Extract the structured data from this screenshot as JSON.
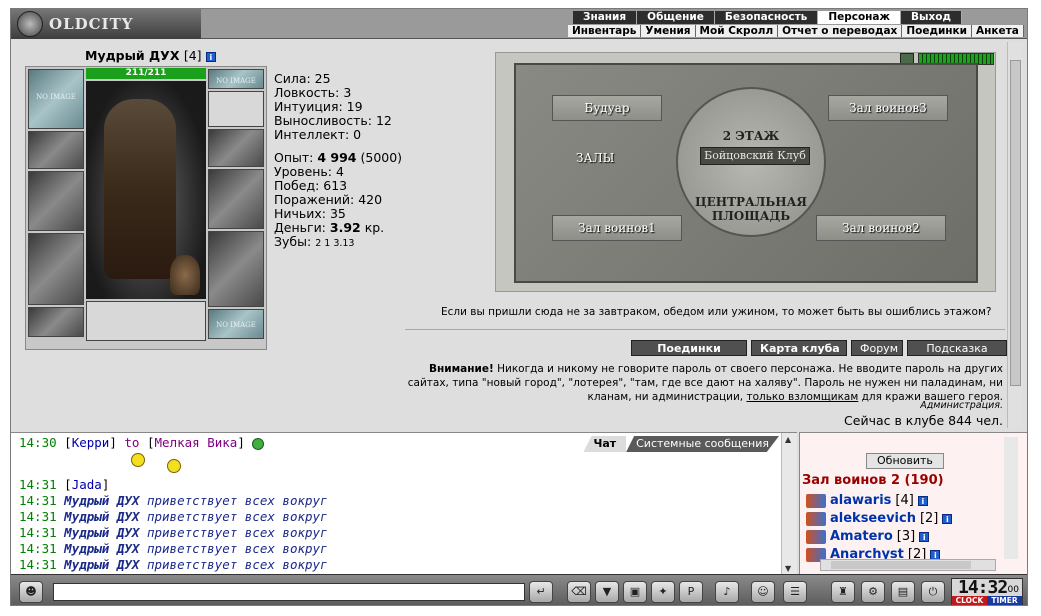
{
  "logo": {
    "text": "OLDCITY"
  },
  "nav_primary": [
    {
      "label": "Знания",
      "active": false
    },
    {
      "label": "Общение",
      "active": false
    },
    {
      "label": "Безопасность",
      "active": false
    },
    {
      "label": "Персонаж",
      "active": true
    },
    {
      "label": "Выход",
      "active": false
    }
  ],
  "nav_secondary": [
    "Инвентарь",
    "Умения",
    "Мой Скролл",
    "Отчет о переводах",
    "Поединки",
    "Анкета"
  ],
  "character": {
    "name": "Мудрый ДУХ",
    "level": "[4]",
    "info_icon": "i",
    "hp": "211/211",
    "hp_fraction": 1.0,
    "slot_noimage_label": "NO IMAGE"
  },
  "stats": {
    "strength": "Сила: 25",
    "agility": "Ловкость: 3",
    "intuition": "Интуиция: 19",
    "endurance": "Выносливость: 12",
    "intellect": "Интеллект: 0",
    "exp_label": "Опыт: ",
    "exp_value": "4 994",
    "exp_next": " (5000)",
    "level": "Уровень: 4",
    "wins": "Побед: 613",
    "losses": "Поражений: 420",
    "draws": "Ничьих: 35",
    "money_label": "Деньги: ",
    "money_value": "3.92",
    "money_unit": " кр.",
    "teeth_label": "Зубы: ",
    "teeth_values": "2 1 3.13"
  },
  "map": {
    "floor": "2 ЭТАЖ",
    "fight_club": "Бойцовский Клуб",
    "halls": "ЗАЛЫ",
    "center1": "ЦЕНТРАЛЬНАЯ",
    "center2": "ПЛОЩАДЬ",
    "rooms": {
      "boudoir": "Будуар",
      "hall3": "Зал воинов3",
      "hall1": "Зал воинов1",
      "hall2": "Зал воинов2"
    }
  },
  "hint_text": "Если вы пришли сюда не за завтраком, обедом или ужином, то может быть вы ошиблись этажом?",
  "buttons": {
    "fights": "Поединки",
    "club_map": "Карта клуба",
    "forum": "Форум",
    "help": "Подсказка"
  },
  "warning": {
    "bold": "Внимание!",
    "text1": " Никогда и никому не говорите пароль от своего персонажа. Не вводите пароль на других сайтах, типа \"новый город\", \"лотерея\", \"там, где все дают на халяву\". Пароль не нужен ни паладинам, ни кланам, ни администрации, ",
    "link": "только взломщикам",
    "text2": " для кражи вашего героя.",
    "signature": "Администрация."
  },
  "online": "Сейчас в клубе 844 чел.",
  "chat_tabs": {
    "chat": "Чат",
    "system": "Системные сообщения"
  },
  "chat": {
    "msg1": {
      "time": "14:30",
      "from": "Керри",
      "to_word": " to ",
      "to": "Мелкая Вика"
    },
    "msg2": {
      "time": "14:31",
      "from": "Jada"
    },
    "greet_time": "14:31",
    "greet_name": "Мудрый ДУХ",
    "greet_text": " приветствует всех вокруг",
    "greet_count": 5
  },
  "users_panel": {
    "refresh": "Обновить",
    "room": "Зал воинов 2 (190)",
    "users": [
      {
        "name": "alawaris",
        "level": "[4]"
      },
      {
        "name": "alekseevich",
        "level": "[2]"
      },
      {
        "name": "Amatero",
        "level": "[3]"
      },
      {
        "name": "Anarchyst",
        "level": "[2]"
      }
    ]
  },
  "clock": {
    "time": "14:32",
    "seconds": "00",
    "clock_label": "CLOCK",
    "timer_label": "TIMER"
  },
  "bottom_icons": [
    "chat-mode-icon",
    "send-icon",
    "clear-icon",
    "filter-icon",
    "save-icon",
    "fight-icon",
    "translit-icon",
    "music-icon",
    "smiley-icon",
    "contacts-icon",
    "inventory-icon",
    "settings-icon",
    "print-icon",
    "exit-icon"
  ]
}
